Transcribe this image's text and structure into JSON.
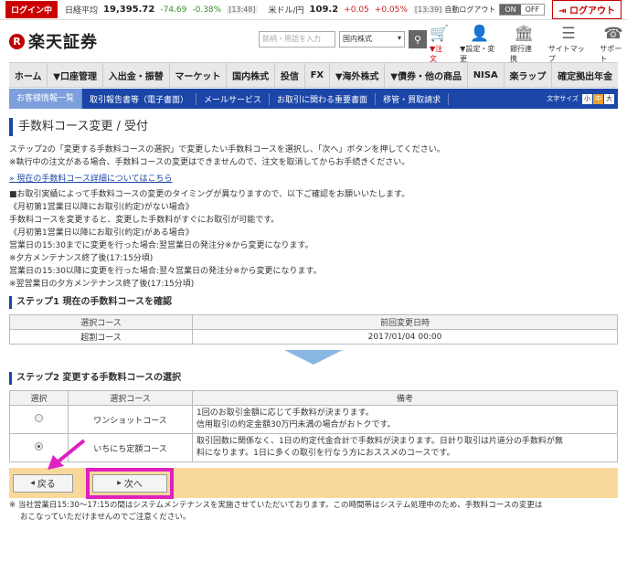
{
  "topbar": {
    "login_badge": "ログイン中",
    "index_name": "日経平均",
    "index_value": "19,395.72",
    "index_change": "-74.69",
    "index_pct": "-0.38%",
    "index_time": "[13:48]",
    "fx_name": "米ドル/円",
    "fx_value": "109.2",
    "fx_change": "+0.05",
    "fx_pct": "+0.05%",
    "fx_time": "[13:39]",
    "autologout_label": "自動ログアウト",
    "toggle_on": "ON",
    "toggle_off": "OFF",
    "logout_label": "ログアウト"
  },
  "header": {
    "logo_text": "楽天証券",
    "logo_mark": "R",
    "search_placeholder": "銘柄・用語を入力",
    "search_select": "国内株式",
    "icons": [
      {
        "label": "▼注文"
      },
      {
        "label": "▼設定・変更"
      },
      {
        "label": "銀行連携"
      },
      {
        "label": "サイトマップ"
      },
      {
        "label": "サポート"
      }
    ]
  },
  "nav": {
    "items": [
      "ホーム",
      "▼口座管理",
      "入出金・振替",
      "マーケット",
      "国内株式",
      "投信",
      "FX",
      "▼海外株式",
      "▼債券・他の商品",
      "NISA",
      "楽ラップ",
      "確定拠出年金"
    ]
  },
  "subnav": {
    "items": [
      "お客様情報一覧",
      "取引報告書等（電子書面）",
      "メールサービス",
      "お取引に関わる重要書面",
      "移管・買取請求"
    ],
    "font_size_label": "文字サイズ",
    "font_sizes": [
      "小",
      "中",
      "大"
    ]
  },
  "page": {
    "title": "手数料コース変更 / 受付",
    "intro1": "ステップ2の「変更する手数料コースの選択」で変更したい手数料コースを選択し、「次へ」ボタンを押してください。",
    "intro2": "※執行中の注文がある場合、手数料コースの変更はできませんので、注文を取消してからお手続きください。",
    "detail_link": "» 現在の手数料コース詳細についてはこちら",
    "note1": "■お取引実績によって手数料コースの変更のタイミングが異なりますので、以下ご確認をお願いいたします。",
    "note2": "《月初第1営業日以降にお取引(約定)がない場合》",
    "note3": "手数料コースを変更すると、変更した手数料がすぐにお取引が可能です。",
    "note4": "《月初第1営業日以降にお取引(約定)がある場合》",
    "note5": "営業日の15:30までに変更を行った場合:翌営業日の発注分※から変更になります。",
    "note6": "※夕方メンテナンス終了後(17:15分頃)",
    "note7": "営業日の15:30以降に変更を行った場合:翌々営業日の発注分※から変更になります。",
    "note8": "※翌営業日の夕方メンテナンス終了後(17:15分頃)"
  },
  "step1": {
    "heading": "ステップ1 現在の手数料コースを確認",
    "col_course": "選択コース",
    "col_date": "前回変更日時",
    "course": "超割コース",
    "date": "2017/01/04 00:00"
  },
  "step2": {
    "heading": "ステップ2 変更する手数料コースの選択",
    "col_select": "選択",
    "col_course": "選択コース",
    "col_note": "備考",
    "rows": [
      {
        "course": "ワンショットコース",
        "note1": "1回のお取引金額に応じて手数料が決まります。",
        "note2": "信用取引の約定金額30万円未満の場合がおトクです。"
      },
      {
        "course": "いちにち定額コース",
        "note1": "取引回数に関係なく、1日の約定代金合計で手数料が決まります。日計り取引は片道分の手数料が無",
        "note2": "料になります。1日に多くの取引を行なう方におススメのコースです。"
      }
    ]
  },
  "buttons": {
    "back": "戻る",
    "next": "次へ"
  },
  "footer": {
    "line1": "※ 当社営業日15:30～17:15の間はシステムメンテナンスを実施させていただいております。この時間帯はシステム処理中のため、手数料コースの変更は",
    "line2": "おこなっていただけませんのでご注意ください。"
  },
  "colors": {
    "brand_red": "#bf0000",
    "nav_blue": "#1b46a8",
    "highlight_magenta": "#e020c0",
    "button_bar": "#f9d89c"
  }
}
